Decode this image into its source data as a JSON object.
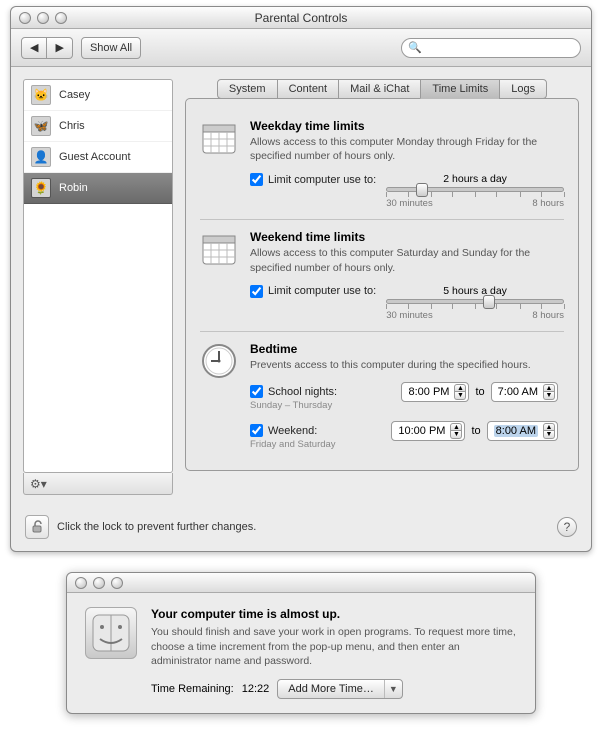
{
  "window": {
    "title": "Parental Controls",
    "show_all_label": "Show All",
    "search_placeholder": ""
  },
  "users": [
    {
      "name": "Casey",
      "selected": false
    },
    {
      "name": "Chris",
      "selected": false
    },
    {
      "name": "Guest Account",
      "selected": false
    },
    {
      "name": "Robin",
      "selected": true
    }
  ],
  "tabs": [
    {
      "label": "System",
      "active": false
    },
    {
      "label": "Content",
      "active": false
    },
    {
      "label": "Mail & iChat",
      "active": false
    },
    {
      "label": "Time Limits",
      "active": true
    },
    {
      "label": "Logs",
      "active": false
    }
  ],
  "weekday": {
    "title": "Weekday time limits",
    "desc": "Allows access to this computer Monday through Friday for the specified number of hours only.",
    "checkbox_label": "Limit computer use to:",
    "checked": true,
    "value_label": "2 hours a day",
    "slider_pct": 20,
    "min_label": "30 minutes",
    "max_label": "8 hours"
  },
  "weekend": {
    "title": "Weekend time limits",
    "desc": "Allows access to this computer Saturday and Sunday for the specified number of hours only.",
    "checkbox_label": "Limit computer use to:",
    "checked": true,
    "value_label": "5 hours a day",
    "slider_pct": 58,
    "min_label": "30 minutes",
    "max_label": "8 hours"
  },
  "bedtime": {
    "title": "Bedtime",
    "desc": "Prevents access to this computer during the specified hours.",
    "school": {
      "checkbox_label": "School nights:",
      "checked": true,
      "sublabel": "Sunday – Thursday",
      "from": "8:00 PM",
      "to_label": "to",
      "to": "7:00 AM"
    },
    "weekend": {
      "checkbox_label": "Weekend:",
      "checked": true,
      "sublabel": "Friday and Saturday",
      "from": "10:00 PM",
      "to_label": "to",
      "to": "8:00 AM"
    }
  },
  "footer": {
    "lock_text": "Click the lock to prevent further changes."
  },
  "dialog": {
    "title": "Your computer time is almost up.",
    "desc": "You should finish and save your work in open programs. To request more time, choose a time increment from the pop-up menu, and then enter an administrator name and password.",
    "remaining_label": "Time Remaining:",
    "remaining_value": "12:22",
    "button_label": "Add More Time…"
  }
}
